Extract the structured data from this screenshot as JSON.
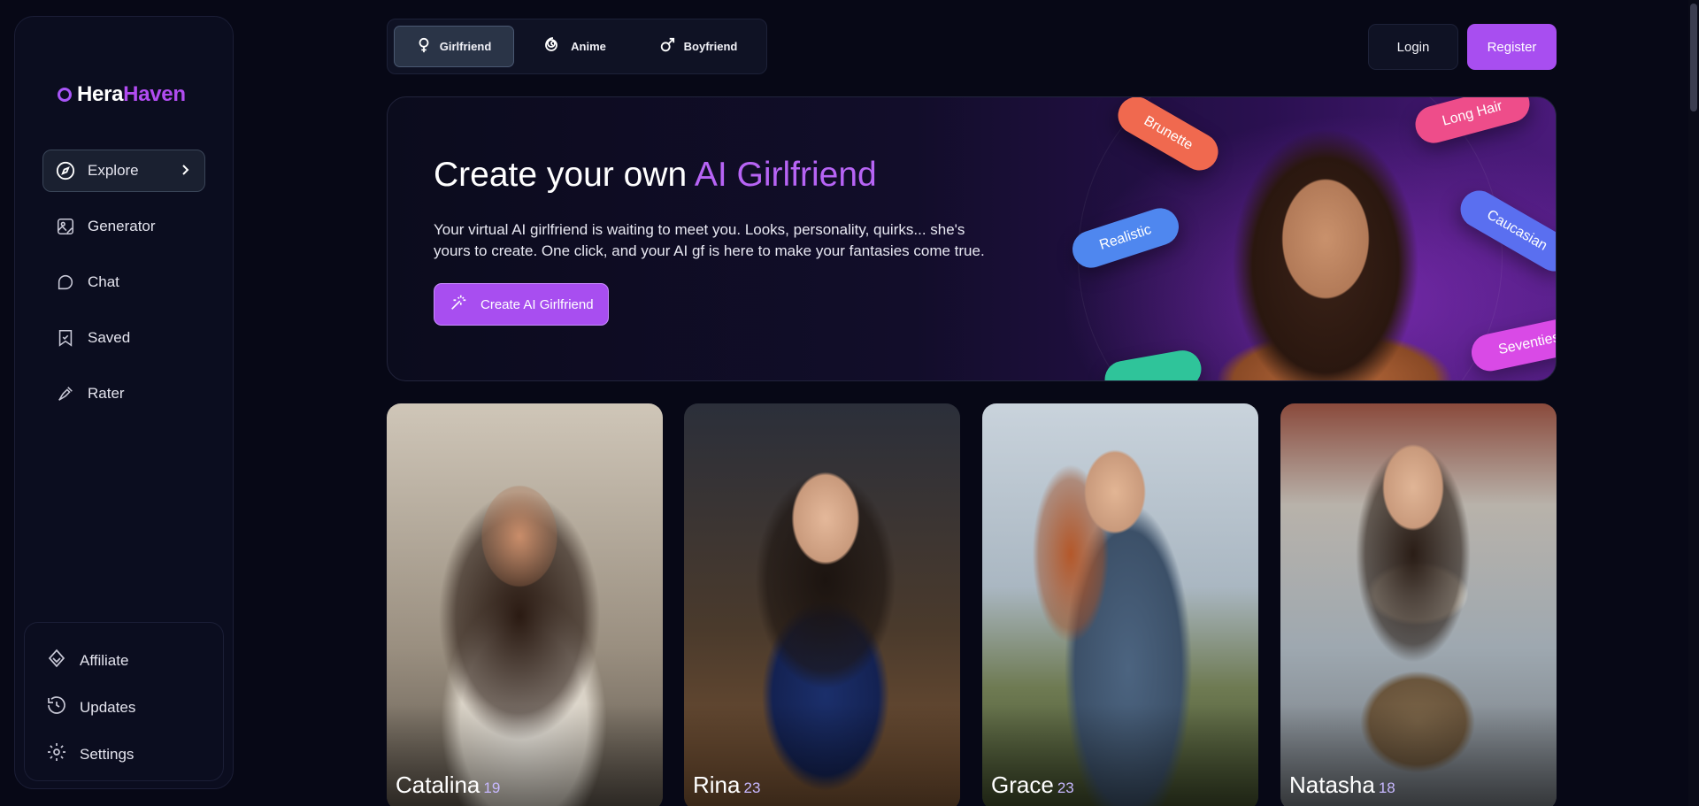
{
  "brand": {
    "name_part1": "Hera",
    "name_part2": "Haven"
  },
  "sidebar": {
    "items": [
      {
        "label": "Explore",
        "icon": "compass-icon"
      },
      {
        "label": "Generator",
        "icon": "image-edit-icon"
      },
      {
        "label": "Chat",
        "icon": "chat-bubble-icon"
      },
      {
        "label": "Saved",
        "icon": "bookmark-icon"
      },
      {
        "label": "Rater",
        "icon": "rater-icon"
      }
    ],
    "bottom_items": [
      {
        "label": "Affiliate",
        "icon": "affiliate-icon"
      },
      {
        "label": "Updates",
        "icon": "history-icon"
      },
      {
        "label": "Settings",
        "icon": "gear-icon"
      }
    ]
  },
  "type_tabs": [
    {
      "label": "Girlfriend",
      "icon": "female-symbol-icon",
      "active": true
    },
    {
      "label": "Anime",
      "icon": "spiral-icon",
      "active": false
    },
    {
      "label": "Boyfriend",
      "icon": "male-symbol-icon",
      "active": false
    }
  ],
  "auth": {
    "login_label": "Login",
    "register_label": "Register"
  },
  "hero": {
    "title_prefix": "Create your own ",
    "title_accent": "AI Girlfriend",
    "description": "Your virtual AI girlfriend is waiting to meet you. Looks, personality, quirks... she's yours to create. One click, and your AI gf is here to make your fantasies come true.",
    "cta_label": "Create AI Girlfriend",
    "tags": [
      "Brunette",
      "Long Hair",
      "Realistic",
      "Caucasian",
      "Seventies"
    ]
  },
  "cards": [
    {
      "name": "Catalina",
      "age": "19"
    },
    {
      "name": "Rina",
      "age": "23"
    },
    {
      "name": "Grace",
      "age": "23"
    },
    {
      "name": "Natasha",
      "age": "18"
    }
  ],
  "colors": {
    "accent": "#a84ef0",
    "brand_accent": "#b14cf0",
    "background": "#070816",
    "panel": "#0b0d1f"
  }
}
